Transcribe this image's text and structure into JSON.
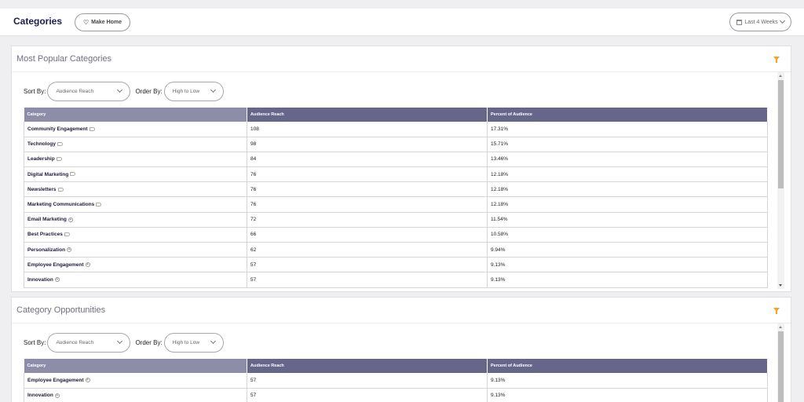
{
  "header": {
    "title": "Categories",
    "make_home_label": "Make Home",
    "date_range_label": "Last 4 Weeks"
  },
  "panels": [
    {
      "title": "Most Popular Categories",
      "sort_by_label": "Sort By:",
      "sort_by_value": "Audience Reach",
      "order_by_label": "Order By:",
      "order_by_value": "High to Low",
      "columns": [
        "Category",
        "Audience Reach",
        "Percent of Audience"
      ],
      "rows": [
        {
          "category": "Community Engagement",
          "icon": "tag-icon",
          "reach": "108",
          "percent": "17.31%"
        },
        {
          "category": "Technology",
          "icon": "tag-icon",
          "reach": "98",
          "percent": "15.71%"
        },
        {
          "category": "Leadership",
          "icon": "tag-icon",
          "reach": "84",
          "percent": "13.46%"
        },
        {
          "category": "Digital Marketing",
          "icon": "tag-icon",
          "reach": "76",
          "percent": "12.18%"
        },
        {
          "category": "Newsletters",
          "icon": "tag-icon",
          "reach": "76",
          "percent": "12.18%"
        },
        {
          "category": "Marketing Communications",
          "icon": "tag-icon",
          "reach": "76",
          "percent": "12.18%"
        },
        {
          "category": "Email Marketing",
          "icon": "plus-circle-icon",
          "reach": "72",
          "percent": "11.54%"
        },
        {
          "category": "Best Practices",
          "icon": "tag-icon",
          "reach": "66",
          "percent": "10.58%"
        },
        {
          "category": "Personalization",
          "icon": "plus-circle-icon",
          "reach": "62",
          "percent": "9.94%"
        },
        {
          "category": "Employee Engagement",
          "icon": "plus-circle-icon",
          "reach": "57",
          "percent": "9.13%"
        },
        {
          "category": "Innovation",
          "icon": "plus-circle-icon",
          "reach": "57",
          "percent": "9.13%"
        }
      ]
    },
    {
      "title": "Category Opportunities",
      "sort_by_label": "Sort By:",
      "sort_by_value": "Audience Reach",
      "order_by_label": "Order By:",
      "order_by_value": "High to Low",
      "columns": [
        "Category",
        "Audience Reach",
        "Percent of Audience"
      ],
      "rows": [
        {
          "category": "Employee Engagement",
          "icon": "plus-circle-icon",
          "reach": "57",
          "percent": "9.13%"
        },
        {
          "category": "Innovation",
          "icon": "plus-circle-icon",
          "reach": "57",
          "percent": "9.13%"
        }
      ]
    }
  ],
  "colors": {
    "header_bg": "#66668a",
    "accent": "#f0a52a",
    "title": "#1d1b4f"
  }
}
